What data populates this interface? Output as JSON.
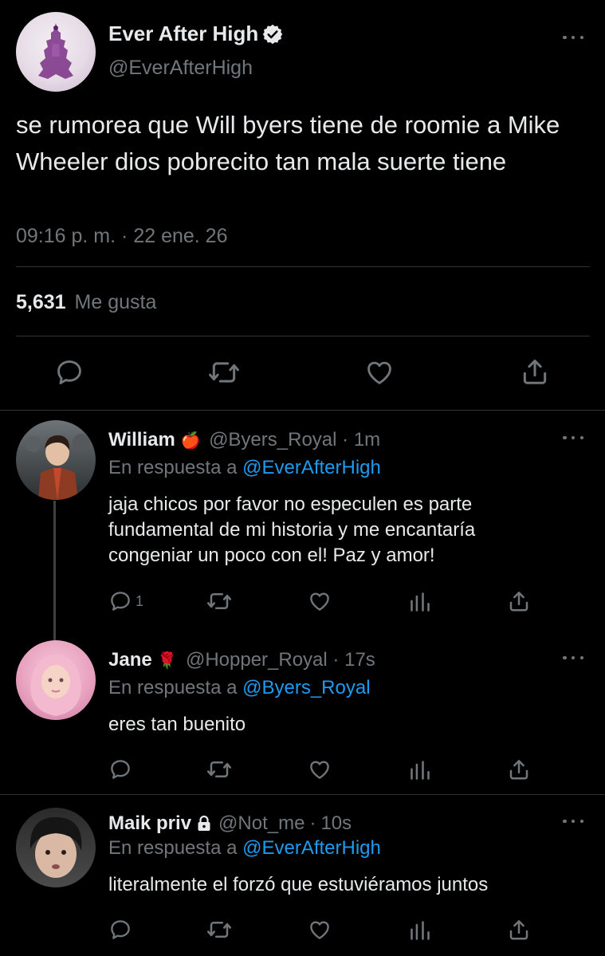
{
  "main_tweet": {
    "author_name": "Ever After High",
    "handle": "@EverAfterHigh",
    "text": "se rumorea que Will byers tiene de roomie a Mike Wheeler dios pobrecito tan mala suerte tiene",
    "time": "09:16 p. m.",
    "separator": "·",
    "date": "22 ene. 26",
    "likes_count": "5,631",
    "likes_label": "Me gusta"
  },
  "replies": [
    {
      "author_name": "William",
      "emoji": "🍎",
      "handle": "@Byers_Royal",
      "separator": "·",
      "age": "1m",
      "reply_prefix": "En respuesta a",
      "reply_to": "@EverAfterHigh",
      "text": "jaja chicos por favor no especulen es parte fundamental de mi historia y me encantaría congeniar un poco con el! Paz y amor!",
      "reply_count": "1"
    },
    {
      "author_name": "Jane",
      "emoji": "🌹",
      "handle": "@Hopper_Royal",
      "separator": "·",
      "age": "17s",
      "reply_prefix": "En respuesta a",
      "reply_to": "@Byers_Royal",
      "text": "eres tan buenito"
    },
    {
      "author_name": "Maik priv",
      "handle": "@Not_me",
      "separator": "·",
      "age": "10s",
      "reply_prefix": "En respuesta a",
      "reply_to": "@EverAfterHigh",
      "text": "literalmente el forzó que estuviéramos juntos"
    }
  ],
  "colors": {
    "background": "#000000",
    "text": "#e7e9ea",
    "secondary": "#71767b",
    "link": "#1d9bf0",
    "divider": "#2f3336"
  },
  "icons": [
    "verified-badge-icon",
    "lock-icon",
    "reply-icon",
    "retweet-icon",
    "like-icon",
    "share-icon",
    "analytics-icon",
    "more-icon"
  ]
}
